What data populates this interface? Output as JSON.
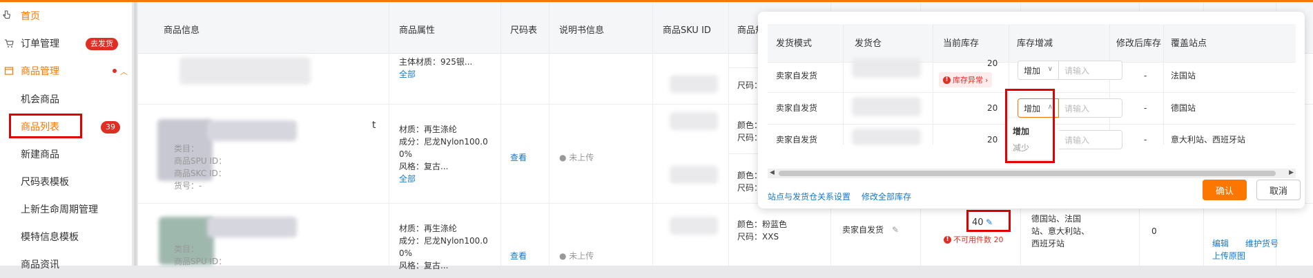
{
  "colors": {
    "accent": "#fb7701",
    "danger": "#e02e24",
    "link": "#1677cc"
  },
  "sidebar": {
    "home": "首页",
    "orders": "订单管理",
    "orders_badge": "去发货",
    "products": "商品管理",
    "items": [
      {
        "label": "机会商品"
      },
      {
        "label": "商品列表",
        "badge": "39"
      },
      {
        "label": "新建商品"
      },
      {
        "label": "尺码表模板"
      },
      {
        "label": "上新生命周期管理"
      },
      {
        "label": "模特信息模板"
      },
      {
        "label": "商品资讯"
      }
    ]
  },
  "table": {
    "headers": {
      "product_info": "商品信息",
      "attributes": "商品属性",
      "size_chart": "尺码表",
      "manual": "说明书信息",
      "sku_id": "商品SKU ID",
      "sku_attr": "商品规"
    },
    "row0": {
      "attr_line": "主体材质：925银...",
      "all_link": "全部",
      "size_label": "尺码："
    },
    "row1": {
      "id_labels": [
        "类目：",
        "商品SPU ID：",
        "商品SKC ID：",
        "货号：-"
      ],
      "trailing_t": "t",
      "attrs": [
        "材质：再生涤纶",
        "成分：尼龙Nylon100.0",
        "0%",
        "风格：复古..."
      ],
      "all_link": "全部",
      "view_link": "查看",
      "manual_status": "未上传",
      "color_label": "颜色：",
      "size_label": "尺码：",
      "color_label_2": "颜色：",
      "size_label_2": "尺码："
    },
    "row2": {
      "id_labels": [
        "类目：",
        "商品SPU ID："
      ],
      "attrs": [
        "材质：再生涤纶",
        "成分：尼龙Nylon100.0",
        "0%",
        "风格：复古..."
      ],
      "view_link": "查看",
      "manual_status": "未上传",
      "color": "颜色：粉蓝色",
      "size": "尺码：XXS",
      "ship_mode": "卖家自发货",
      "stock_value": "40",
      "stock_error": "不可用件数 20",
      "sites": [
        "德国站、法国",
        "站、意大利站、",
        "西班牙站"
      ],
      "number": "0",
      "actions": [
        "编辑",
        "维护货号"
      ],
      "upload_link": "上传原图"
    }
  },
  "popover": {
    "headers": {
      "ship_mode": "发货模式",
      "warehouse": "发货仓",
      "current_stock": "当前库存",
      "stock_change": "库存增减",
      "after_stock": "修改后库存",
      "sites": "覆盖站点"
    },
    "rows": [
      {
        "ship_mode": "卖家自发货",
        "current_stock": "20",
        "stock_error": "库存异常",
        "select": "增加",
        "placeholder": "请输入",
        "after": "-",
        "sites": "法国站"
      },
      {
        "ship_mode": "卖家自发货",
        "current_stock": "20",
        "select": "增加",
        "placeholder": "请输入",
        "after": "-",
        "sites": "德国站"
      },
      {
        "ship_mode": "卖家自发货",
        "current_stock": "20",
        "select": "增加",
        "placeholder": "请输入",
        "after": "-",
        "sites": "意大利站、西班牙站"
      }
    ],
    "dropdown": [
      "增加",
      "减少"
    ],
    "footer_links": [
      "站点与发货仓关系设置",
      "修改全部库存"
    ],
    "confirm": "确认",
    "cancel": "取消"
  }
}
